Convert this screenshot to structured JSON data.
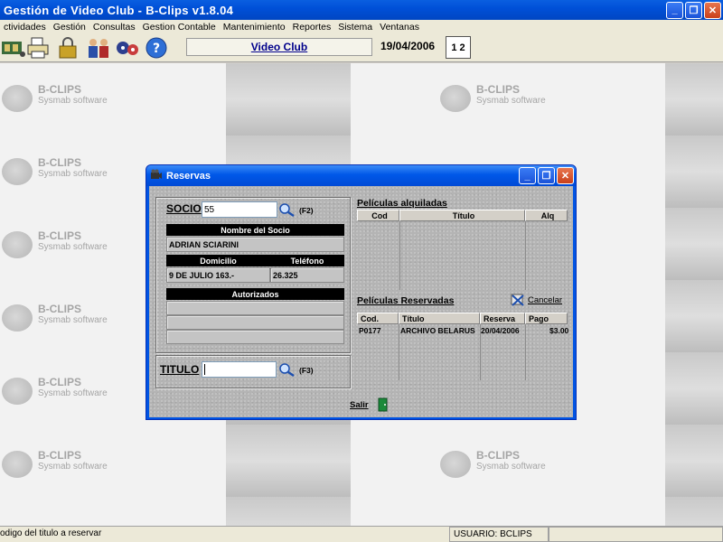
{
  "window": {
    "title": "Gestión de Video Club - B-Clips v1.8.04"
  },
  "menu": [
    "ctividades",
    "Gestión",
    "Consultas",
    "Gestion Contable",
    "Mantenimiento",
    "Reportes",
    "Sistema",
    "Ventanas"
  ],
  "toolbar": {
    "center_label": "Video Club",
    "date": "19/04/2006",
    "calendar_label": "1 2",
    "icons": [
      "films-icon",
      "printer-icon",
      "lock-icon",
      "people-icon",
      "reels-icon",
      "help-icon"
    ]
  },
  "background_logo": {
    "name": "B-CLIPS",
    "sub": "Sysmab software"
  },
  "dialog": {
    "title": "Reservas",
    "socio": {
      "label": "SOCIO",
      "value": "55",
      "shortcut": "(F2)",
      "name_header": "Nombre del Socio",
      "name_value": "ADRIAN SCIARINI",
      "domicilio_header": "Domicilio",
      "telefono_header": "Teléfono",
      "domicilio_value": "9 DE JULIO 163.-",
      "telefono_value": "26.325",
      "autorizados_header": "Autorizados"
    },
    "titulo": {
      "label": "TITULO",
      "value": "",
      "shortcut": "(F3)"
    },
    "alquiladas": {
      "label": "Películas alquiladas",
      "columns": [
        "Cod",
        "Título",
        "Alq"
      ]
    },
    "reservadas": {
      "label": "Películas Reservadas",
      "cancel_label": "Cancelar",
      "columns": [
        "Cod.",
        "Título",
        "Reserva",
        "Pago"
      ],
      "rows": [
        {
          "cod": "P0177",
          "titulo": "ARCHIVO BELARUS",
          "reserva": "20/04/2006",
          "pago": "$3.00"
        }
      ]
    },
    "exit_label": "Salir"
  },
  "status": {
    "message": "odigo del titulo a reservar",
    "user": "USUARIO: BCLIPS"
  },
  "colors": {
    "title_blue": "#0054e3",
    "link_blue": "#00008b"
  }
}
